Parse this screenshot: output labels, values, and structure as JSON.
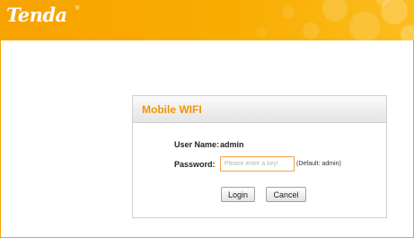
{
  "brand": {
    "logo_text": "Tenda",
    "registered_mark": "®",
    "header_color": "#F7A300",
    "accent_color": "#F29600"
  },
  "login": {
    "title": "Mobile WIFI",
    "username_label": "User Name:",
    "username_value": "admin",
    "password_label": "Password:",
    "password_placeholder": "Please enter a key!",
    "password_hint": "(Default: admin)",
    "login_button": "Login",
    "cancel_button": "Cancel"
  }
}
